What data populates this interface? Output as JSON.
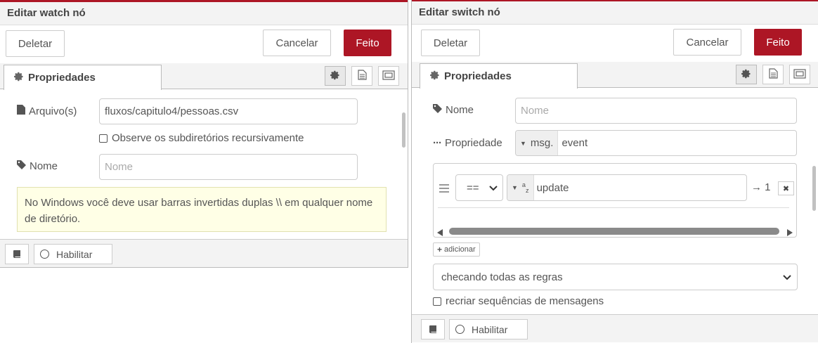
{
  "left": {
    "title": "Editar watch nó",
    "buttons": {
      "delete": "Deletar",
      "cancel": "Cancelar",
      "done": "Feito"
    },
    "tab_label": "Propriedades",
    "fields": {
      "file_label": "Arquivo(s)",
      "file_value": "fluxos/capitulo4/pessoas.csv",
      "recursive_label": "Observe os subdiretórios recursivamente",
      "name_label": "Nome",
      "name_placeholder": "Nome"
    },
    "tip": "No Windows você deve usar barras invertidas duplas \\\\ em qualquer nome de diretório.",
    "footer": {
      "enable_label": "Habilitar"
    }
  },
  "right": {
    "title": "Editar switch nó",
    "buttons": {
      "delete": "Deletar",
      "cancel": "Cancelar",
      "done": "Feito"
    },
    "tab_label": "Propriedades",
    "fields": {
      "name_label": "Nome",
      "name_placeholder": "Nome",
      "property_label": "Propriedade",
      "property_prefix": "msg.",
      "property_value": "event"
    },
    "rule": {
      "operator": "==",
      "type_symbol": "a",
      "type_sub": "z",
      "value": "update",
      "output": "→ 1"
    },
    "add_label": "adicionar",
    "checking_select": "checando todas as regras",
    "recreate_label": "recriar sequências de mensagens",
    "footer": {
      "enable_label": "Habilitar"
    }
  },
  "colors": {
    "accent": "#ad1625",
    "tip_bg": "#ffffe6"
  },
  "icons": [
    "gear-icon",
    "file-icon",
    "tag-icon",
    "ellipsis-icon",
    "book-icon",
    "layout-icon",
    "drag-handle-icon",
    "close-icon",
    "plus-icon",
    "chevron-down-icon"
  ]
}
